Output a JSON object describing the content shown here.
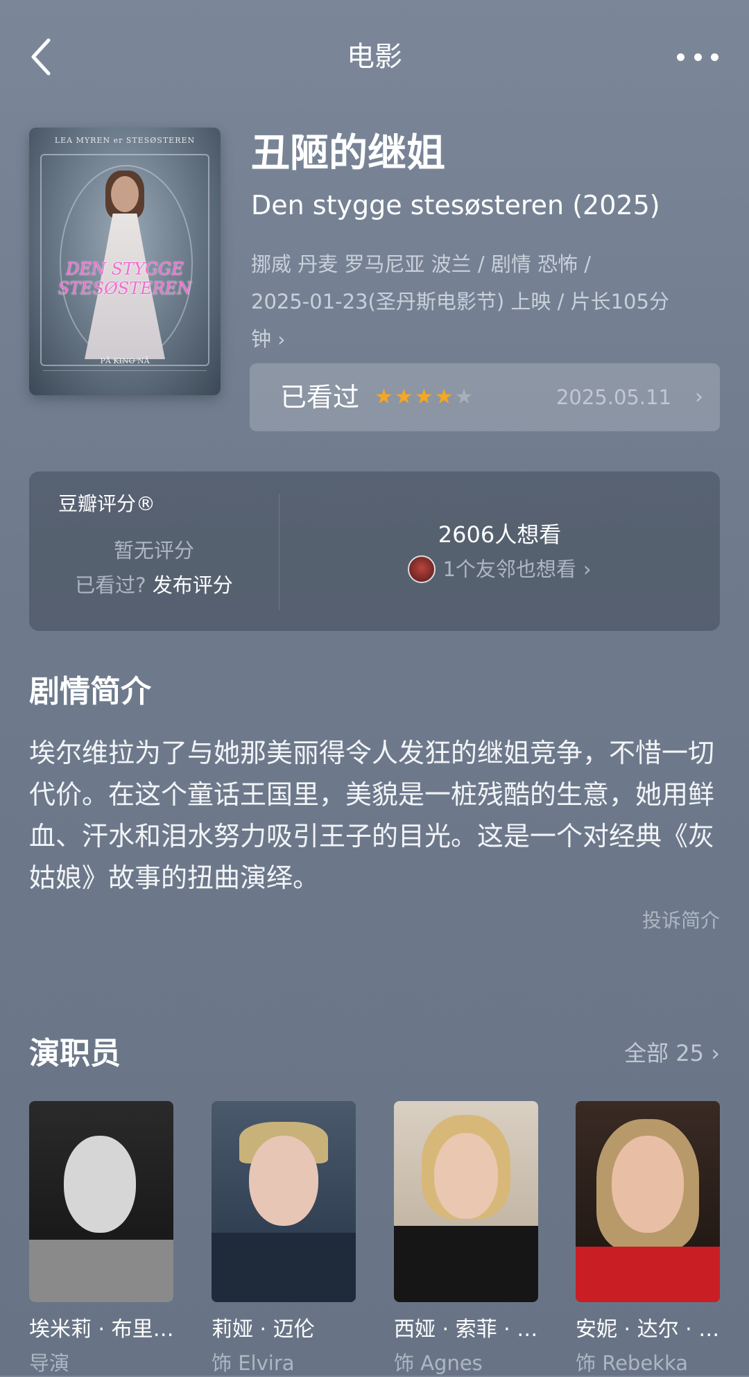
{
  "header": {
    "title": "电影"
  },
  "poster": {
    "top_text": "LEA MYREN er STESØSTEREN",
    "title_line1": "DEN STYGGE",
    "title_line2": "STESØSTEREN",
    "bottom_text": "PÅ KINO NÅ"
  },
  "movie": {
    "title": "丑陋的继姐",
    "original_title": "Den stygge stesøsteren (2025)",
    "meta_line1": "挪威 丹麦 罗马尼亚 波兰 / 剧情 恐怖 /",
    "meta_line2": "2025-01-23(圣丹斯电影节) 上映 / 片长105分",
    "meta_line3": "钟"
  },
  "watched": {
    "label": "已看过",
    "rating_stars": 4,
    "max_stars": 5,
    "date": "2025.05.11"
  },
  "rating": {
    "label": "豆瓣评分®",
    "no_rating": "暂无评分",
    "seen_question": "已看过?",
    "publish": "发布评分",
    "wish_count": "2606人想看",
    "friends": "1个友邻也想看"
  },
  "synopsis": {
    "title": "剧情简介",
    "text": "埃尔维拉为了与她那美丽得令人发狂的继姐竞争，不惜一切代价。在这个童话王国里，美貌是一桩残酷的生意，她用鲜血、汗水和泪水努力吸引王子的目光。这是一个对经典《灰姑娘》故事的扭曲演绎。",
    "report": "投诉简介"
  },
  "cast": {
    "title": "演职员",
    "all_label": "全部 25",
    "members": [
      {
        "name": "埃米莉 · 布里…",
        "role": "导演"
      },
      {
        "name": "莉娅 · 迈伦",
        "role": "饰 Elvira"
      },
      {
        "name": "西娅 · 索菲 · …",
        "role": "饰 Agnes"
      },
      {
        "name": "安妮 · 达尔 · …",
        "role": "饰 Rebekka"
      }
    ]
  },
  "colors": {
    "star_on": "#f5a623",
    "star_off": "#a8afb9",
    "background": "#74808f"
  }
}
